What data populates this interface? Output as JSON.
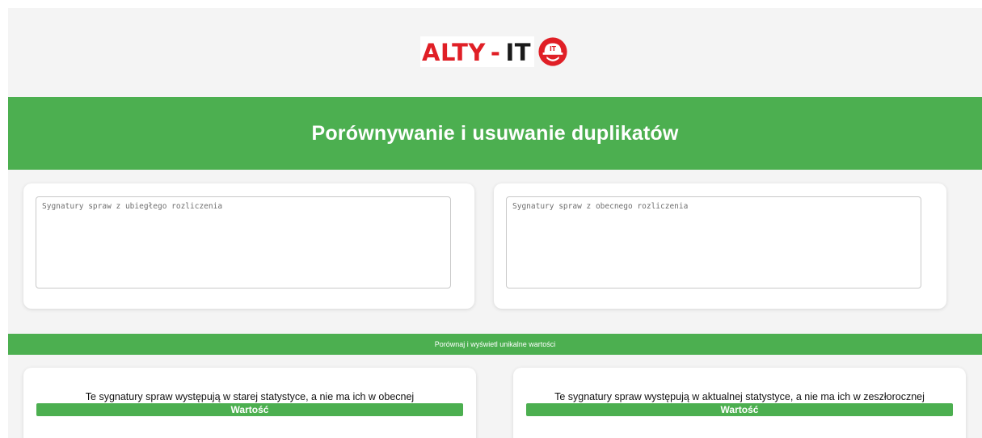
{
  "logo": {
    "text_main": "ALTY",
    "text_dash": "-",
    "text_it": "IT",
    "badge_text": "IT",
    "brand_red": "#e01f26",
    "icon": "hardhat-icon"
  },
  "header": {
    "title": "Porównywanie i usuwanie duplikatów",
    "color": "#4caf50"
  },
  "inputs": {
    "previous_placeholder": "Sygnatury spraw z ubiegłego rozliczenia",
    "current_placeholder": "Sygnatury spraw z obecnego rozliczenia"
  },
  "actions": {
    "compare_label": "Porównaj i wyświetl unikalne wartości"
  },
  "results": {
    "old_only": {
      "title": "Te sygnatury spraw występują w starej statystyce, a nie ma ich w obecnej",
      "column_header": "Wartość"
    },
    "new_only": {
      "title": "Te sygnatury spraw występują w aktualnej statystyce, a nie ma ich w zeszłorocznej",
      "column_header": "Wartość"
    }
  }
}
